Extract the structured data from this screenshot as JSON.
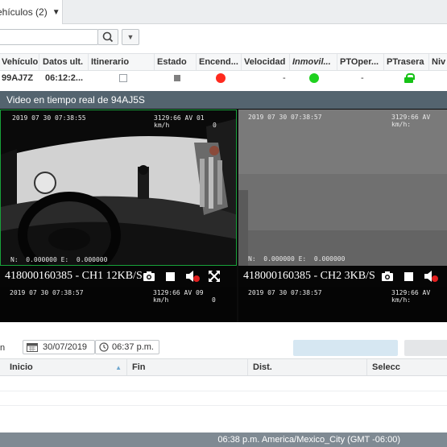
{
  "tab": {
    "label": "ehículos (2)"
  },
  "vehicle_table": {
    "columns": [
      "Vehículo",
      "Datos ult.",
      "Itinerario",
      "Estado",
      "Encend...",
      "Velocidad",
      "Inmovil...",
      "PTOper...",
      "PTrasera",
      "Niv"
    ],
    "row": {
      "vehiculo": "99AJ7Z",
      "datos_ult": "06:12:2...",
      "velocidad": "-",
      "ptoper": "-"
    }
  },
  "video_dialog": {
    "title": "Video en tiempo real de 94AJ5S",
    "channel1": {
      "label": "418000160385 - CH1 12KB/S",
      "timestamp": "2019 07 30 07:38:55",
      "speed_top": "3129:66 AV 01",
      "speed_unit": "km/h",
      "speed_value": "0",
      "coords": "N:  0.000000 E:  0.000000",
      "bottom_time": "2019 07 30 07:38:57",
      "bottom_speed": "3129:66 AV 09",
      "bottom_unit": "km/h",
      "bottom_value": "0"
    },
    "channel2": {
      "label": "418000160385 - CH2 3KB/S",
      "timestamp": "2019 07 30 07:38:57",
      "speed_top": "3129:66 AV",
      "speed_unit": "km/h:",
      "coords": "N:  0.000000 E:  0.000000",
      "bottom_time": "2019 07 30 07:38:57",
      "bottom_speed": "3129:66 AV",
      "bottom_unit": "km/h:"
    }
  },
  "filters": {
    "prefix": "n",
    "date": "30/07/2019",
    "time": "06:37 p.m."
  },
  "results_table": {
    "columns": [
      "Inicio",
      "Fin",
      "Dist.",
      "Selecc"
    ]
  },
  "status_bar": {
    "text": "06:38 p.m. America/Mexico_City (GMT -06:00)"
  }
}
